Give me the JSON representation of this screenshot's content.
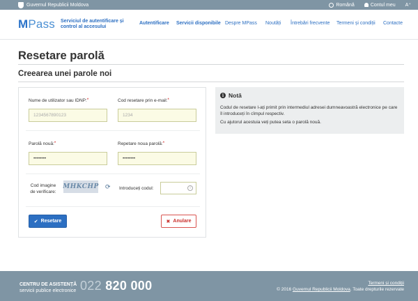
{
  "govbar": {
    "title": "Guvernul Republicii Moldova",
    "language": "Română",
    "account": "Contul meu",
    "font_toggle": "A⁺"
  },
  "header": {
    "logo": "MPass",
    "logo_m": "M",
    "logo_rest": "Pass",
    "tagline": "Serviciul de autentificare și control al accesului",
    "nav": [
      "Autentificare",
      "Servicii disponibile",
      "Despre MPass",
      "Noutăți",
      "Întrebări frecvente",
      "Termeni și condiții",
      "Contacte"
    ]
  },
  "page": {
    "title": "Resetare parolă",
    "subtitle": "Creearea unei parole noi"
  },
  "form": {
    "username_label": "Nume de utilizator sau IDNP:",
    "username_placeholder": "1234567890123",
    "code_label": "Cod resetare prin e-mail:",
    "code_placeholder": "1234",
    "password_label": "Parolă nouă:",
    "password_value": "••••••••",
    "repeat_label": "Repetare noua parolă:",
    "repeat_value": "••••••••",
    "captcha_label_1": "Cod imagine",
    "captcha_label_2": "de verificare:",
    "captcha_text": "MHKCHP",
    "captcha_input_label": "Introduceți codul:",
    "required_mark": "*",
    "reset_button": "Resetare",
    "cancel_button": "Anulare"
  },
  "note": {
    "title": "Notă",
    "line1": "Codul de resetare l-ați primit prin intermediul adresei dumneavoastră electronice pe care îl introduceți în cîmpul respectiv.",
    "line2": "Cu ajutorul acestuia veți putea seta o parolă nouă."
  },
  "footer": {
    "support_title": "CENTRU DE ASISTENȚĂ",
    "support_sub": "servicii publice electronice",
    "phone_prefix": "022",
    "phone_number": "820 000",
    "terms": "Termeni și condiții",
    "copyright_pre": "© 2016",
    "copyright_link": "Guvernul Republicii Moldova",
    "copyright_post": ". Toate drepturile rezervate"
  },
  "colors": {
    "primary": "#2c6fc2",
    "bar": "#7f95a4",
    "danger": "#d9534f",
    "input_bg": "#fbfbe5"
  }
}
